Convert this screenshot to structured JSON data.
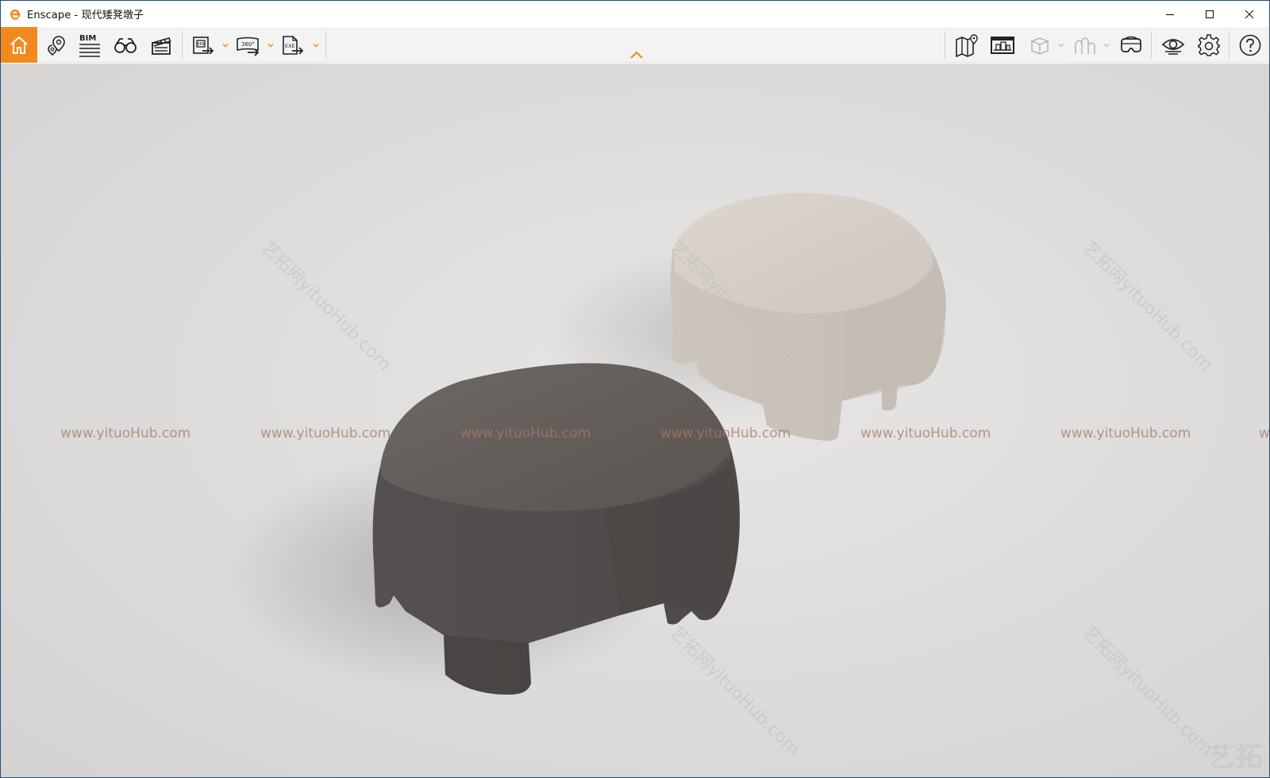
{
  "window": {
    "title": "Enscape - 现代矮凳墩子",
    "controls": {
      "minimize": "minimize-icon",
      "maximize": "maximize-icon",
      "close": "close-icon"
    }
  },
  "toolbar": {
    "accent_color": "#f08a1c",
    "left_tools": [
      {
        "name": "home",
        "icon": "home-icon",
        "active": true
      },
      {
        "name": "views",
        "icon": "location-pin-icon"
      },
      {
        "name": "bim",
        "icon": "bim-icon",
        "label": "BIM"
      },
      {
        "name": "assets",
        "icon": "binoculars-icon"
      },
      {
        "name": "video",
        "icon": "clapperboard-icon"
      }
    ],
    "export_tools": [
      {
        "name": "batch-render",
        "icon": "batch-export-icon",
        "has_dropdown": true
      },
      {
        "name": "panorama",
        "icon": "panorama-360-icon",
        "label": "360°",
        "has_dropdown": true
      },
      {
        "name": "exe-export",
        "icon": "exe-export-icon",
        "label": "EXE",
        "has_dropdown": true
      }
    ],
    "right_tools": [
      {
        "name": "map",
        "icon": "map-pin-icon"
      },
      {
        "name": "monitor",
        "icon": "monitor-building-icon"
      },
      {
        "name": "cube",
        "icon": "cube-icon",
        "has_dropdown": true,
        "disabled": true
      },
      {
        "name": "site",
        "icon": "site-context-icon",
        "has_dropdown": true,
        "disabled": true
      },
      {
        "name": "vr",
        "icon": "vr-headset-icon"
      },
      {
        "name": "visual-settings",
        "icon": "eye-icon"
      },
      {
        "name": "settings",
        "icon": "gear-icon"
      },
      {
        "name": "help",
        "icon": "help-icon"
      }
    ],
    "collapse": "chevron-up-icon"
  },
  "viewport": {
    "watermark_text": "www.yituoHub.com",
    "watermark_repeats": [
      "www.yituoHub.com",
      "www.yituoHub.com",
      "www.yituoHub.com",
      "www.yituoHub.com",
      "www.yituoHub.com",
      "www.yituoHub.com",
      "w"
    ],
    "diagonal_watermark": "艺拓网yituoHub.com",
    "corner_logo": "艺拓",
    "objects": [
      {
        "name": "dark-ottoman",
        "color": "#5c5653"
      },
      {
        "name": "light-ottoman",
        "color": "#d8d2cb"
      }
    ]
  }
}
